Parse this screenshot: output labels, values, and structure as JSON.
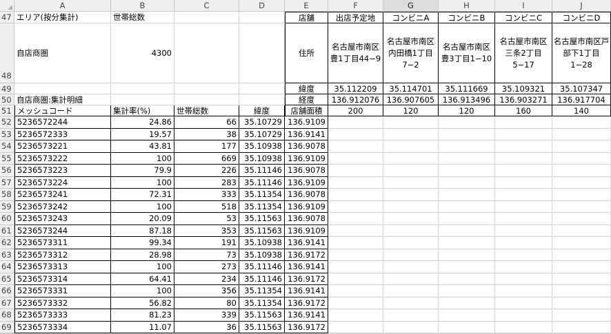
{
  "columns": [
    "A",
    "B",
    "C",
    "D",
    "E",
    "F",
    "G",
    "H",
    "I",
    "J"
  ],
  "selected_column": "G",
  "rows": {
    "r47": {
      "num": "47",
      "A": "エリア(按分集計)",
      "B": "世帯総数",
      "E": "店舗",
      "F": "出店予定地",
      "G": "コンビニA",
      "H": "コンビニB",
      "I": "コンビニC",
      "J": "コンビニD"
    },
    "r48": {
      "num": "48",
      "A": "自店商圏",
      "B": "4300",
      "E": "住所",
      "F": "名古屋市南区豊1丁目44−9",
      "G": "名古屋市南区内田橋1丁目7−2",
      "H": "名古屋市南区豊3丁目1−10",
      "I": "名古屋市南区三条2丁目5−17",
      "J": "名古屋市南区戸部下1丁目1−28"
    },
    "r49": {
      "num": "49",
      "E": "緯度",
      "F": "35.112209",
      "G": "35.114701",
      "H": "35.111669",
      "I": "35.109321",
      "J": "35.107347"
    },
    "r50": {
      "num": "50",
      "A": "自店商圏:集計明細",
      "E": "経度",
      "F": "136.912076",
      "G": "136.907605",
      "H": "136.913496",
      "I": "136.903271",
      "J": "136.917704"
    },
    "r51": {
      "num": "51",
      "A": "メッシュコード",
      "B": "集計率(%)",
      "C": "世帯総数",
      "D": "緯度",
      "E": "店舗面積",
      "F": "200",
      "G": "120",
      "H": "120",
      "I": "160",
      "J": "140"
    }
  },
  "mesh_rows": [
    {
      "num": "52",
      "code": "5236572244",
      "rate": "24.86",
      "hh": "66",
      "lat": "35.10729",
      "lon": "136.9109"
    },
    {
      "num": "53",
      "code": "5236572333",
      "rate": "19.57",
      "hh": "38",
      "lat": "35.10729",
      "lon": "136.9141"
    },
    {
      "num": "54",
      "code": "5236573221",
      "rate": "43.81",
      "hh": "177",
      "lat": "35.10938",
      "lon": "136.9078"
    },
    {
      "num": "55",
      "code": "5236573222",
      "rate": "100",
      "hh": "669",
      "lat": "35.10938",
      "lon": "136.9109"
    },
    {
      "num": "56",
      "code": "5236573223",
      "rate": "79.9",
      "hh": "226",
      "lat": "35.11146",
      "lon": "136.9078"
    },
    {
      "num": "57",
      "code": "5236573224",
      "rate": "100",
      "hh": "283",
      "lat": "35.11146",
      "lon": "136.9109"
    },
    {
      "num": "58",
      "code": "5236573241",
      "rate": "72.31",
      "hh": "333",
      "lat": "35.11354",
      "lon": "136.9078"
    },
    {
      "num": "59",
      "code": "5236573242",
      "rate": "100",
      "hh": "518",
      "lat": "35.11354",
      "lon": "136.9109"
    },
    {
      "num": "60",
      "code": "5236573243",
      "rate": "20.09",
      "hh": "53",
      "lat": "35.11563",
      "lon": "136.9078"
    },
    {
      "num": "61",
      "code": "5236573244",
      "rate": "87.18",
      "hh": "353",
      "lat": "35.11563",
      "lon": "136.9109"
    },
    {
      "num": "62",
      "code": "5236573311",
      "rate": "99.34",
      "hh": "191",
      "lat": "35.10938",
      "lon": "136.9141"
    },
    {
      "num": "63",
      "code": "5236573312",
      "rate": "28.98",
      "hh": "73",
      "lat": "35.10938",
      "lon": "136.9172"
    },
    {
      "num": "64",
      "code": "5236573313",
      "rate": "100",
      "hh": "273",
      "lat": "35.11146",
      "lon": "136.9141"
    },
    {
      "num": "65",
      "code": "5236573314",
      "rate": "64.41",
      "hh": "234",
      "lat": "35.11146",
      "lon": "136.9172"
    },
    {
      "num": "66",
      "code": "5236573331",
      "rate": "100",
      "hh": "356",
      "lat": "35.11354",
      "lon": "136.9141"
    },
    {
      "num": "67",
      "code": "5236573332",
      "rate": "56.82",
      "hh": "80",
      "lat": "35.11354",
      "lon": "136.9172"
    },
    {
      "num": "68",
      "code": "5236573333",
      "rate": "81.23",
      "hh": "339",
      "lat": "35.11563",
      "lon": "136.9141"
    },
    {
      "num": "69",
      "code": "5236573334",
      "rate": "11.07",
      "hh": "36",
      "lat": "35.11563",
      "lon": "136.9172"
    }
  ],
  "colors": {
    "header_bg": "#efefef",
    "grid": "#d4d4d4",
    "border": "#000000"
  }
}
